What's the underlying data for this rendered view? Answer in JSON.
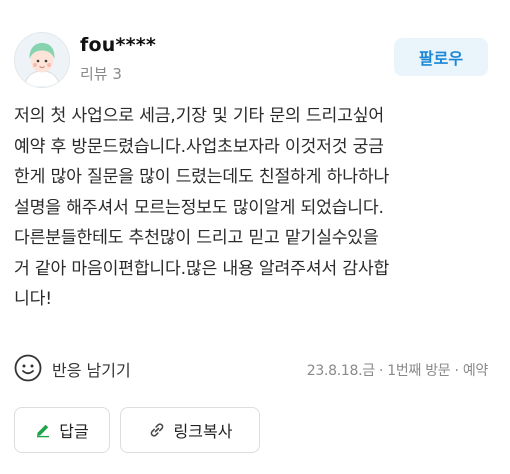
{
  "review": {
    "author": {
      "name": "fou****",
      "review_count": "리뷰 3"
    },
    "follow_label": "팔로우",
    "body": "저의 첫 사업으로 세금,기장 및 기타 문의 드리고싶어\n예약 후 방문드렸습니다.사업초보자라 이것저것 궁금\n한게 많아 질문을 많이 드렸는데도 친절하게 하나하나\n설명을 해주셔서 모르는정보도 많이알게 되었습니다.\n다른분들한테도 추천많이 드리고 믿고 맡기실수있을\n거 같아 마음이편합니다.많은 내용 알려주셔서 감사합\n니다!",
    "reaction_label": "반응 남기기",
    "meta": "23.8.18.금 · 1번째 방문 · 예약",
    "actions": {
      "reply_label": "답글",
      "copy_link_label": "링크복사"
    }
  },
  "colors": {
    "accent": "#1b87d6",
    "follow_bg": "#eaf4fb",
    "reply_icon": "#1fa34a",
    "muted_text": "#8a8a8a"
  },
  "icons": {
    "avatar": "user-avatar-illustration",
    "reaction": "smile-icon",
    "reply": "pencil-icon",
    "copy_link": "link-icon"
  }
}
